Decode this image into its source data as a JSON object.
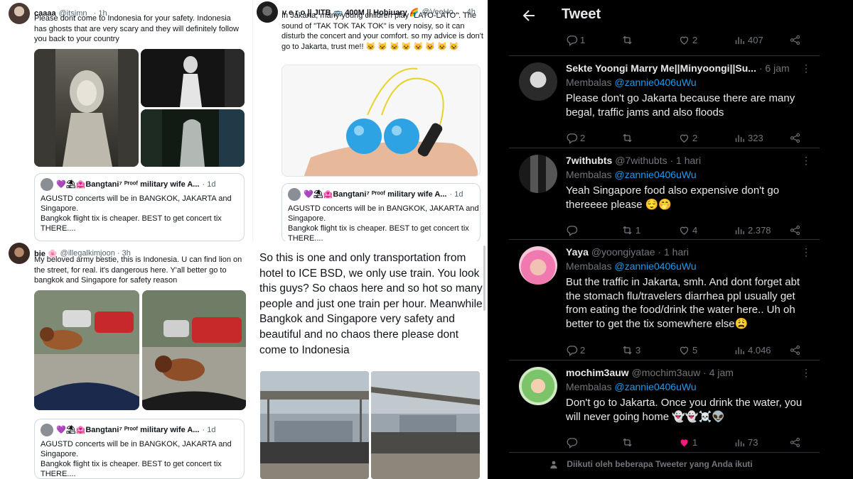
{
  "tweet1": {
    "name": "caaaa",
    "handle_time": "@itsjmn_ · 1h",
    "text": "Please dont come to Indonesia for your safety. Indonesia has ghosts that are very scary and they will definitely follow you back to your country"
  },
  "tweet2": {
    "name": "bie 🌸",
    "handle_time": "@illegalkimjoon · 3h",
    "text": "My beloved army bestie, this is Indonesia. U can find lion on the street, for real. it's dangerous here. Y'all better go to bangkok and Singapore for safety reason"
  },
  "tweet3": {
    "name": "v e r o || JITB 🚌 400M || Hobiuary 🌈",
    "handle_time": "@VeeHo... · 4h",
    "text": "In Jakarta, many young children play \"LATO-LATO\". The sound of \"TAK TOK TAK TOK\" is very noisy, so it can disturb the concert and your comfort. so my advice is don't go to Jakarta, trust me!! 😺 😺 😺 😺 😺 😺 😺 😺"
  },
  "quote": {
    "name": "💜⛱🏩Bangtani⁷ ᴾʳᵒᵒᶠ military wife A...",
    "time": "· 1d",
    "line1": "AGUSTD concerts will be in BANGKOK, JAKARTA and",
    "line2": "Singapore.",
    "line3": "Bangkok flight tix is cheaper. BEST to get concert tix",
    "line4": "THERE...."
  },
  "long_post": {
    "text": "So this is one and only transportation from hotel to ICE BSD, we only use train. You look this guys? So chaos here and so hot so many people and just one train per hour. Meanwhile Bangkok and Singapore very safety and beautiful and no chaos there please dont come to Indonesia"
  },
  "dark": {
    "header_title": "Tweet",
    "replying_label": "Membalas",
    "replying_handle": "@zannie0406uWu",
    "top_actions": {
      "replies": "1",
      "retweets": "",
      "likes": "2",
      "views": "407"
    },
    "replies": [
      {
        "name": "Sekte Yoongi Marry Me||Minyoongi||Su...",
        "meta": " · 6 jam",
        "text": "Please don't go Jakarta because there are many begal, traffic jams and also floods",
        "replies": "2",
        "retweets": "",
        "likes": "2",
        "views": "323"
      },
      {
        "name": "7withubts",
        "meta": " @7withubts · 1 hari",
        "text": "Yeah Singapore food also expensive don't go thereeee please 😌🤭",
        "replies": "",
        "retweets": "1",
        "likes": "4",
        "views": "2.378"
      },
      {
        "name": "Yaya",
        "meta": " @yoongiyatae · 1 hari",
        "text": "But the traffic in Jakarta, smh. And dont forget abt the stomach flu/travelers diarrhea ppl usually get from eating the food/drink the water here.. Uh oh better to get the tix somewhere else😩",
        "replies": "2",
        "retweets": "3",
        "likes": "5",
        "views": "4.046"
      },
      {
        "name": "mochim3auw",
        "meta": " @mochim3auw · 4 jam",
        "text": "Don't go to Jakarta. Once you drink the water, you will never going home 👻👻☠️👽",
        "replies": "",
        "retweets": "",
        "likes": "1",
        "views": "73"
      }
    ],
    "footer": "Diikuti oleh beberapa Tweeter yang Anda ikuti"
  },
  "colors": {
    "accent": "#1d9bf0",
    "like_active": "#f91880",
    "dark_bg": "#000000",
    "muted_dark": "#71767b",
    "muted_light": "#536471"
  },
  "icons": [
    "back-arrow-icon",
    "reply-icon",
    "retweet-icon",
    "like-icon",
    "views-icon",
    "share-icon",
    "more-icon",
    "person-icon"
  ]
}
